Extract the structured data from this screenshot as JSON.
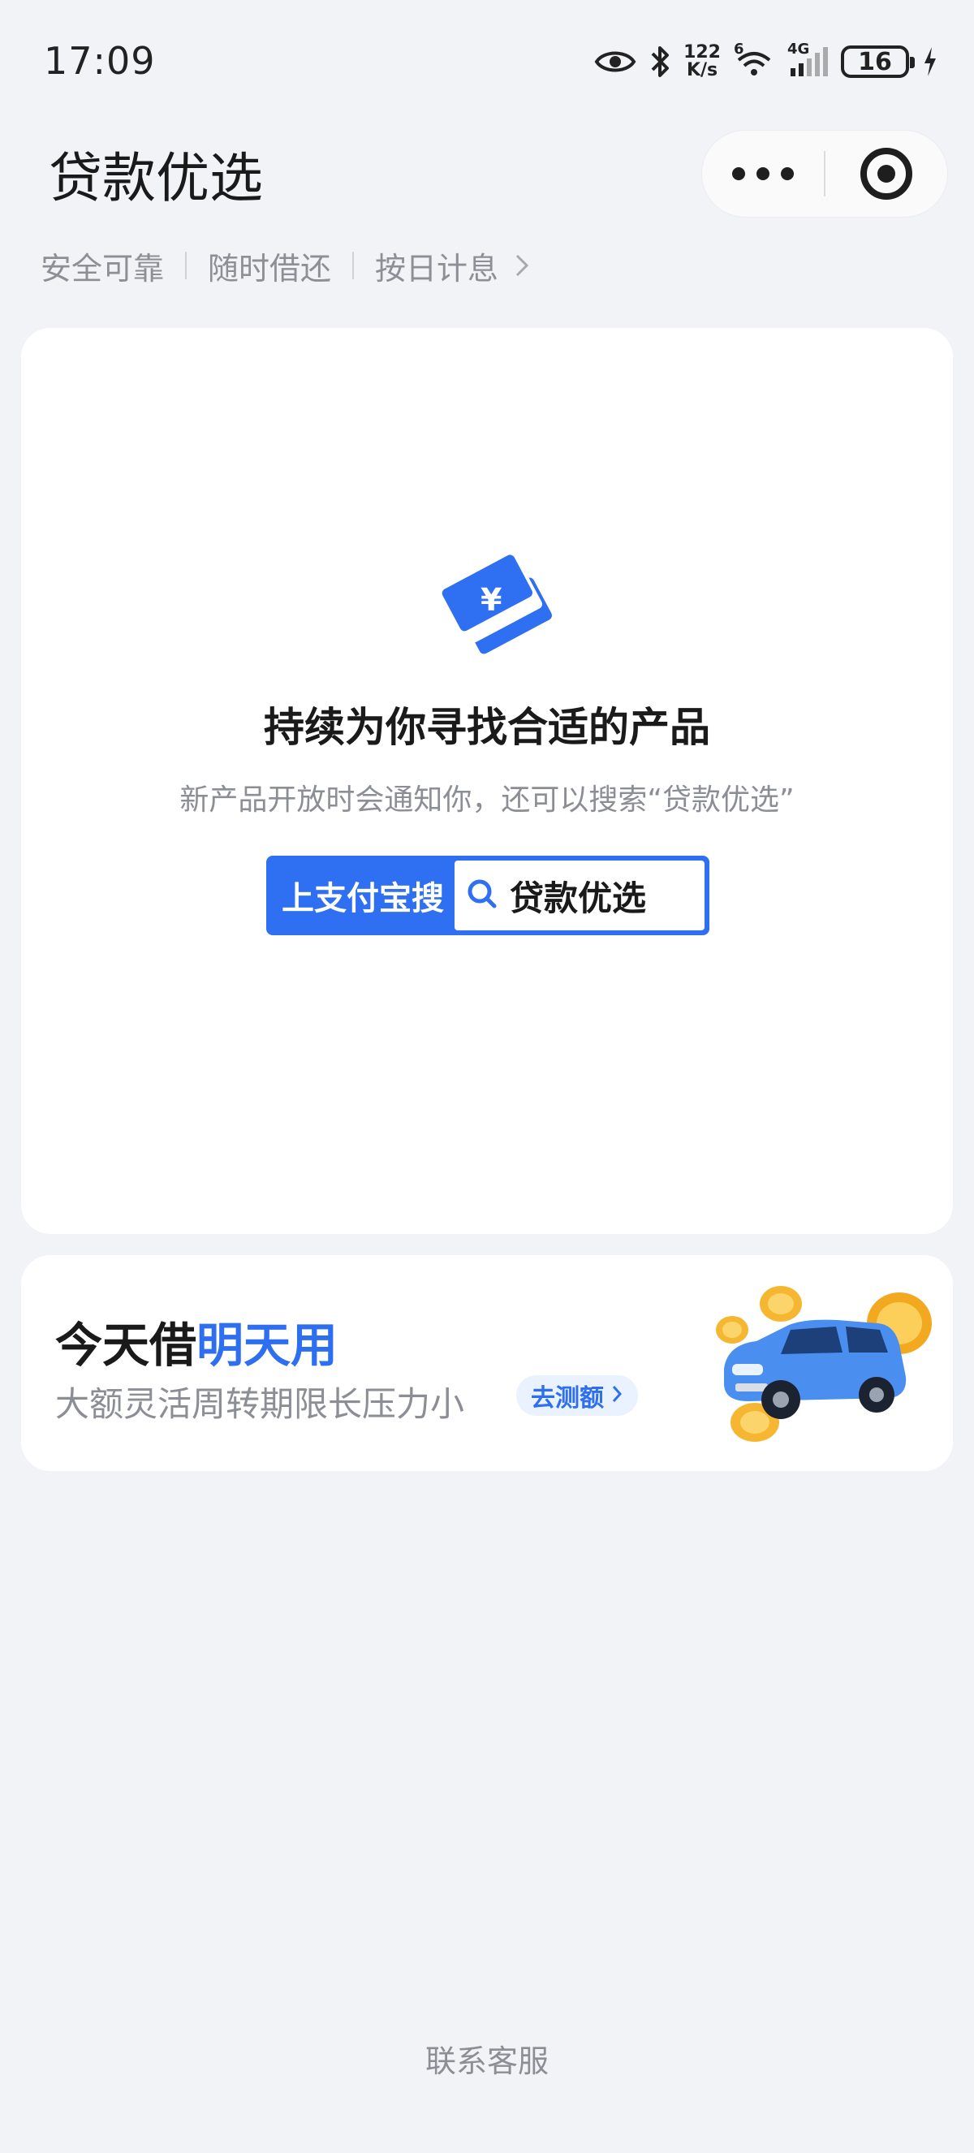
{
  "status_bar": {
    "time": "17:09",
    "net_speed_value": "122",
    "net_speed_unit": "K/s",
    "wifi_label": "6",
    "cellular_label": "4G",
    "battery": "16",
    "icons": [
      "eye-icon",
      "bluetooth-icon",
      "wifi-icon",
      "signal-icon",
      "battery-icon",
      "charging-icon"
    ]
  },
  "header": {
    "title": "贷款优选",
    "capsule_icons": [
      "more-icon",
      "target-icon"
    ]
  },
  "features": {
    "items": [
      "安全可靠",
      "随时借还",
      "按日计息"
    ]
  },
  "main_card": {
    "heading": "持续为你寻找合适的产品",
    "subtext": "新产品开放时会通知你，还可以搜索“贷款优选”",
    "search_left": "上支付宝搜",
    "search_right": "贷款优选",
    "accent": "#2f6ff2"
  },
  "promo_card": {
    "title_black": "今天借",
    "title_blue": "明天用",
    "subtitle": "大额灵活周转期限长压力小",
    "button": "去测额",
    "accent": "#2e6ff0"
  },
  "footer": {
    "link": "联系客服"
  }
}
